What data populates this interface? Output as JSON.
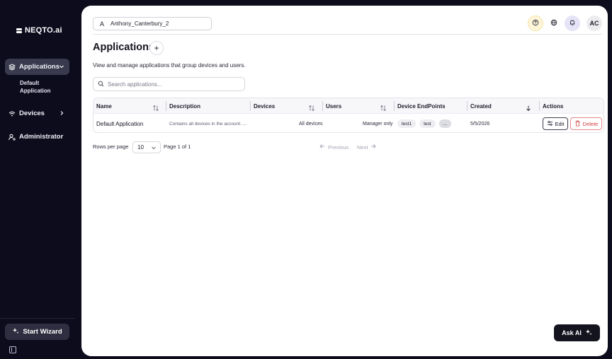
{
  "sidebar": {
    "logo": "NEQTO.ai",
    "items": [
      {
        "label": "Applications"
      },
      {
        "label": "Devices"
      },
      {
        "label": "Administrator"
      }
    ],
    "sub_item": "Default Application",
    "wizard_label": "Start Wizard"
  },
  "header": {
    "account_initial": "A",
    "account_name": "Anthony_Canterbury_2",
    "avatar_initials": "AC"
  },
  "page": {
    "title": "Applications",
    "add_label": "+",
    "subtitle": "View and manage applications that group devices and users.",
    "search_placeholder": "Search applications..."
  },
  "table": {
    "columns": [
      "Name",
      "Description",
      "Devices",
      "Users",
      "Device EndPoints",
      "Created",
      "Actions"
    ],
    "rows": [
      {
        "name": "Default Application",
        "description": "Contains all devices in the account. ...",
        "devices": "All devices",
        "users": "Manager only",
        "endpoints": [
          "test1",
          "test",
          "..."
        ],
        "created": "5/5/2026",
        "edit_label": "Edit",
        "delete_label": "Delete"
      }
    ]
  },
  "pagination": {
    "rows_label": "Rows per page",
    "rows_value": "10",
    "page_info": "Page 1 of 1",
    "previous": "Previous",
    "next": "Next"
  },
  "ask_ai": "Ask AI",
  "colors": {
    "sidebar_bg": "#0d0c1d",
    "active_item": "#3a3a4e",
    "delete_red": "#d24040"
  }
}
